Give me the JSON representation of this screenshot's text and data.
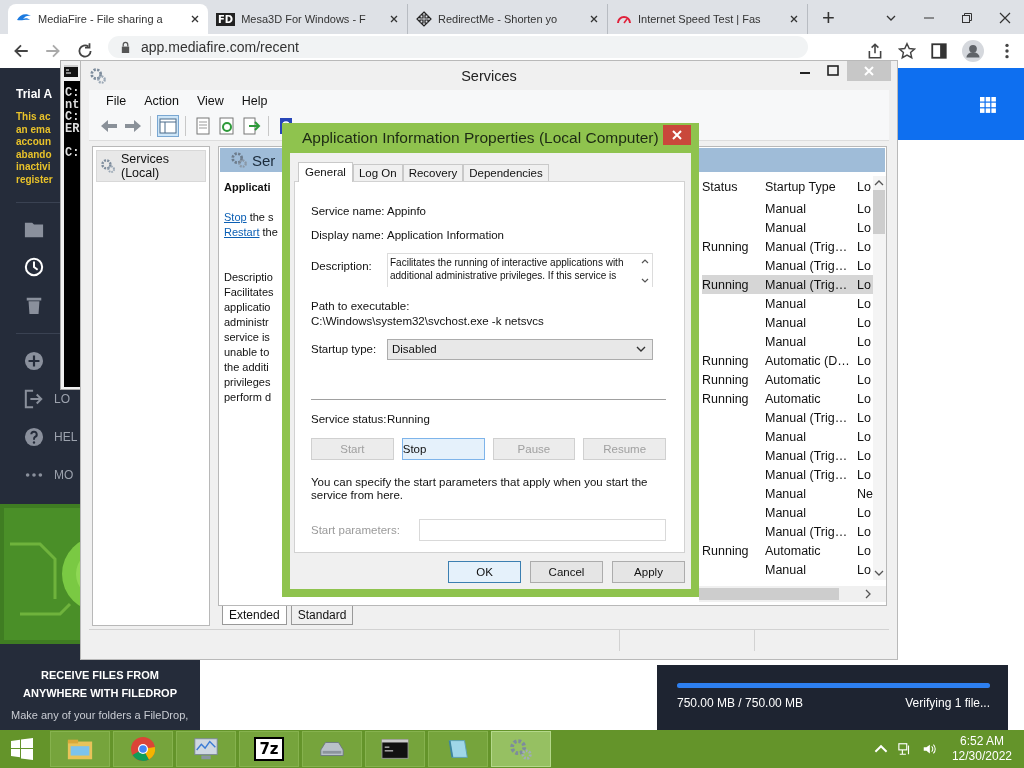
{
  "browser": {
    "tabs": [
      {
        "kind": "mediafire",
        "title": "MediaFire - File sharing a",
        "selected": true
      },
      {
        "kind": "lettered",
        "icon_text": "FD",
        "title": "Mesa3D For Windows - F",
        "selected": false
      },
      {
        "kind": "move",
        "title": "RedirectMe - Shorten yo",
        "selected": false
      },
      {
        "kind": "gauge",
        "title": "Internet Speed Test | Fas",
        "selected": false
      }
    ],
    "new_tab": "+",
    "url": "app.mediafire.com/recent"
  },
  "mediafire": {
    "title": "Trial A",
    "notice_lines": [
      "This ac",
      "an ema",
      "accoun",
      "abando",
      "inactivi",
      "register"
    ],
    "nav": [
      {
        "kind": "folder",
        "selected": false
      },
      {
        "kind": "recent",
        "selected": true
      },
      {
        "kind": "trash",
        "selected": false
      }
    ],
    "actions": [
      {
        "kind": "add"
      },
      {
        "kind": "logout",
        "label": "LO"
      },
      {
        "kind": "help",
        "label": "HEL"
      },
      {
        "kind": "more",
        "label": "MO"
      }
    ],
    "promo": {
      "heading": "RECEIVE FILES FROM ANYWHERE WITH FILEDROP",
      "text": "Make any of your folders a FileDrop,"
    },
    "download": {
      "level": 1,
      "progress": "750.00 MB / 750.00 MB",
      "status": "Verifying 1 file..."
    }
  },
  "console": {
    "lines": [
      "C:",
      "nt",
      "C:",
      "ER",
      "C:"
    ]
  },
  "services": {
    "title": "Services",
    "menu": [
      "File",
      "Action",
      "View",
      "Help"
    ],
    "tree": [
      {
        "label": "Services (Local)",
        "selected": true
      }
    ],
    "pane_title": "Ser",
    "service_name": "Applicati",
    "actions": [
      {
        "link": "Stop",
        "text": "the s"
      },
      {
        "link": "Restart",
        "text": "the"
      }
    ],
    "description_lines": [
      "Descriptio",
      "Facilitates",
      "applicatio",
      "administr",
      "service is",
      "unable to",
      "the additi",
      "privileges",
      "perform d"
    ],
    "columns": [
      "Status",
      "Startup Type",
      "Lo"
    ],
    "rows": [
      {
        "startup": "Manual",
        "log_on": "Lo",
        "selected": false
      },
      {
        "startup": "Manual",
        "log_on": "Lo",
        "selected": false
      },
      {
        "status": "Running",
        "startup": "Manual (Trig…",
        "log_on": "Lo",
        "selected": false
      },
      {
        "startup": "Manual (Trig…",
        "log_on": "Lo",
        "selected": false
      },
      {
        "status": "Running",
        "startup": "Manual (Trig…",
        "log_on": "Lo",
        "selected": true
      },
      {
        "startup": "Manual",
        "log_on": "Lo",
        "selected": false
      },
      {
        "startup": "Manual",
        "log_on": "Lo",
        "selected": false
      },
      {
        "startup": "Manual",
        "log_on": "Lo",
        "selected": false
      },
      {
        "status": "Running",
        "startup": "Automatic (D…",
        "log_on": "Lo",
        "selected": false
      },
      {
        "status": "Running",
        "startup": "Automatic",
        "log_on": "Lo",
        "selected": false
      },
      {
        "status": "Running",
        "startup": "Automatic",
        "log_on": "Lo",
        "selected": false
      },
      {
        "startup": "Manual (Trig…",
        "log_on": "Lo",
        "selected": false
      },
      {
        "startup": "Manual",
        "log_on": "Lo",
        "selected": false
      },
      {
        "startup": "Manual (Trig…",
        "log_on": "Lo",
        "selected": false
      },
      {
        "startup": "Manual (Trig…",
        "log_on": "Lo",
        "selected": false
      },
      {
        "startup": "Manual",
        "log_on": "Ne",
        "selected": false
      },
      {
        "startup": "Manual",
        "log_on": "Lo",
        "selected": false
      },
      {
        "startup": "Manual (Trig…",
        "log_on": "Lo",
        "selected": false
      },
      {
        "status": "Running",
        "startup": "Automatic",
        "log_on": "Lo",
        "selected": false
      },
      {
        "startup": "Manual",
        "log_on": "Lo",
        "selected": false
      }
    ],
    "view_tabs": [
      {
        "label": "Extended",
        "selected": true
      },
      {
        "label": "Standard",
        "selected": false
      }
    ]
  },
  "dialog": {
    "title": "Application Information Properties (Local Computer)",
    "tabs": [
      {
        "label": "General",
        "selected": true
      },
      {
        "label": "Log On",
        "selected": false
      },
      {
        "label": "Recovery",
        "selected": false
      },
      {
        "label": "Dependencies",
        "selected": false
      }
    ],
    "fields": [
      {
        "label": "Service name:",
        "value": "Appinfo"
      },
      {
        "label": "Display name:",
        "value": "Application Information"
      }
    ],
    "description_label": "Description:",
    "description_lines": [
      "Facilitates the running of interactive applications with",
      "additional administrative privileges.  If this service is"
    ],
    "path_label": "Path to executable:",
    "path": "C:\\Windows\\system32\\svchost.exe -k netsvcs",
    "startup_label": "Startup type:",
    "startup_value": "Disabled",
    "status_label": "Service status:",
    "status_value": "Running",
    "control_buttons": [
      {
        "label": "Start",
        "disabled": true
      },
      {
        "label": "Stop",
        "disabled": false
      },
      {
        "label": "Pause",
        "disabled": true
      },
      {
        "label": "Resume",
        "disabled": true
      }
    ],
    "hint": "You can specify the start parameters that apply when you start the service from here.",
    "params_label": "Start parameters:",
    "params_disabled": true,
    "buttons": [
      {
        "label": "OK",
        "focused": true
      },
      {
        "label": "Cancel",
        "focused": false
      },
      {
        "label": "Apply",
        "focused": false
      }
    ]
  },
  "taskbar": {
    "apps": [
      {
        "kind": "explorer",
        "active": false
      },
      {
        "kind": "chrome",
        "active": false
      },
      {
        "kind": "monitor",
        "active": false
      },
      {
        "kind": "archiver",
        "label": "7z",
        "active": false
      },
      {
        "kind": "drive",
        "active": false
      },
      {
        "kind": "console",
        "active": false
      },
      {
        "kind": "notepad",
        "active": false
      },
      {
        "kind": "services",
        "active": true
      }
    ],
    "time": "6:52 AM",
    "date": "12/30/2022"
  }
}
